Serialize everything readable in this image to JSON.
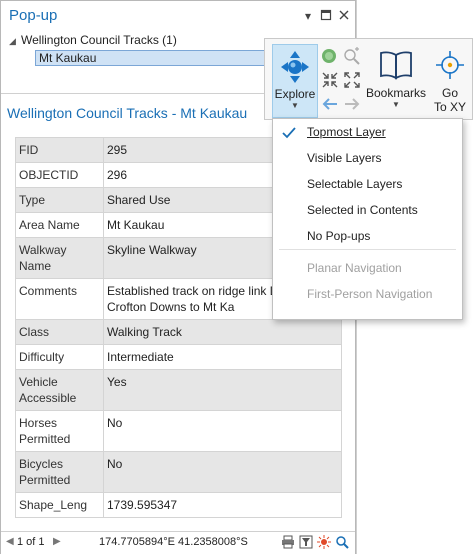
{
  "popup": {
    "title": "Pop-up",
    "layer_label": "Wellington Council Tracks (1)",
    "selected_item": "Mt Kaukau",
    "feature_title": "Wellington Council Tracks - Mt Kaukau",
    "attributes": [
      {
        "key": "FID",
        "value": "295"
      },
      {
        "key": "OBJECTID",
        "value": "296"
      },
      {
        "key": "Type",
        "value": "Shared Use"
      },
      {
        "key": "Area Name",
        "value": "Mt Kaukau"
      },
      {
        "key": "Walkway Name",
        "value": "Skyline Walkway"
      },
      {
        "key": "Comments",
        "value": "Established track on ridge link Drive, Crofton Downs to Mt Ka"
      },
      {
        "key": "Class",
        "value": "Walking Track"
      },
      {
        "key": "Difficulty",
        "value": "Intermediate"
      },
      {
        "key": "Vehicle Accessible",
        "value": "Yes"
      },
      {
        "key": "Horses Permitted",
        "value": "No"
      },
      {
        "key": "Bicycles Permitted",
        "value": "No"
      },
      {
        "key": "Shape_Leng",
        "value": "1739.595347"
      }
    ],
    "pager": "1 of 1",
    "coordinates": "174.7705894°E 41.2358008°S"
  },
  "ribbon": {
    "explore_label": "Explore",
    "bookmarks_label": "Bookmarks",
    "goto_label_line1": "Go",
    "goto_label_line2": "To XY"
  },
  "menu": {
    "items": [
      {
        "label": "Topmost Layer",
        "checked": true,
        "enabled": true
      },
      {
        "label": "Visible Layers",
        "checked": false,
        "enabled": true
      },
      {
        "label": "Selectable Layers",
        "checked": false,
        "enabled": true
      },
      {
        "label": "Selected in Contents",
        "checked": false,
        "enabled": true
      },
      {
        "label": "No Pop-ups",
        "checked": false,
        "enabled": true
      },
      {
        "label": "Planar Navigation",
        "checked": false,
        "enabled": false
      },
      {
        "label": "First-Person Navigation",
        "checked": false,
        "enabled": false
      }
    ]
  },
  "colors": {
    "accent": "#1a6fb5",
    "explore_active_bg": "#cde6f7",
    "row_alt_bg": "#e6e6e6"
  }
}
